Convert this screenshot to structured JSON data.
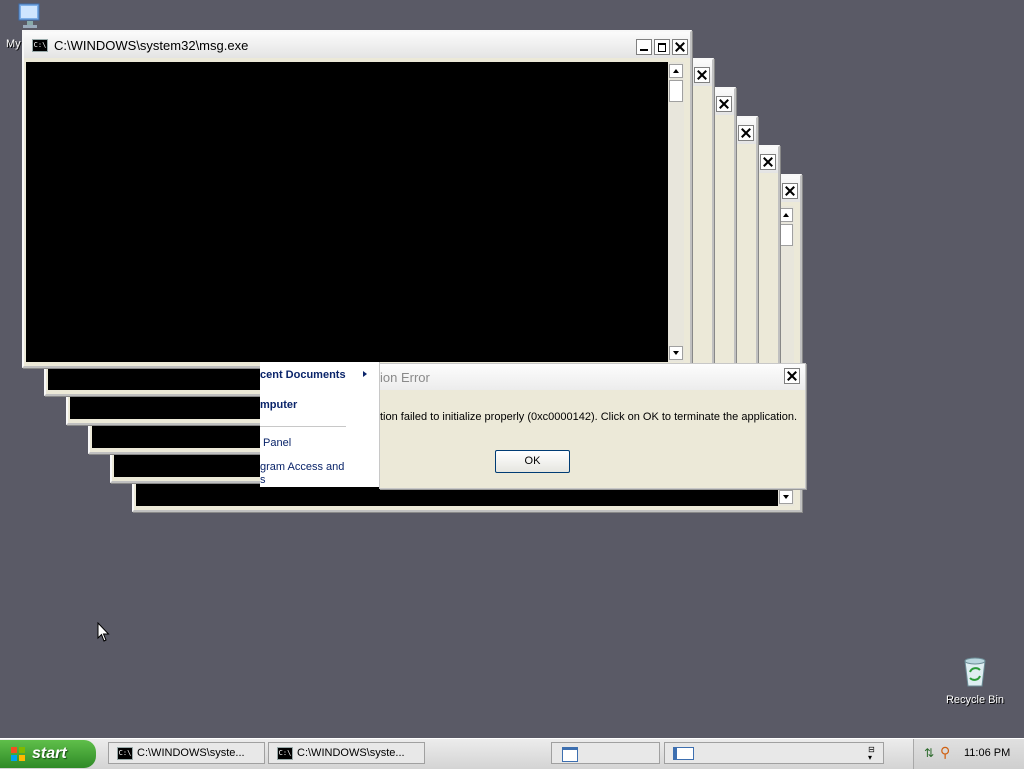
{
  "desktop": {
    "my_computer_label": "My",
    "recycle_bin_label": "Recycle Bin"
  },
  "console_window": {
    "title": "C:\\WINDOWS\\system32\\msg.exe",
    "icon_text": "C:\\"
  },
  "start_menu": {
    "items": [
      "cent Documents",
      "mputer",
      "Panel",
      "gram Access and",
      "s"
    ]
  },
  "error_dialog": {
    "title": "ion Error",
    "message": "tion failed to initialize properly (0xc0000142). Click on OK to terminate the application.",
    "ok_label": "OK"
  },
  "taskbar": {
    "start_label": "start",
    "tasks": [
      "C:\\WINDOWS\\syste...",
      "C:\\WINDOWS\\syste..."
    ],
    "clock": "11:06 PM"
  },
  "colors": {
    "desktop_bg": "#5a5a66",
    "console_bg": "#000000",
    "start_green": "#3a9a30"
  }
}
